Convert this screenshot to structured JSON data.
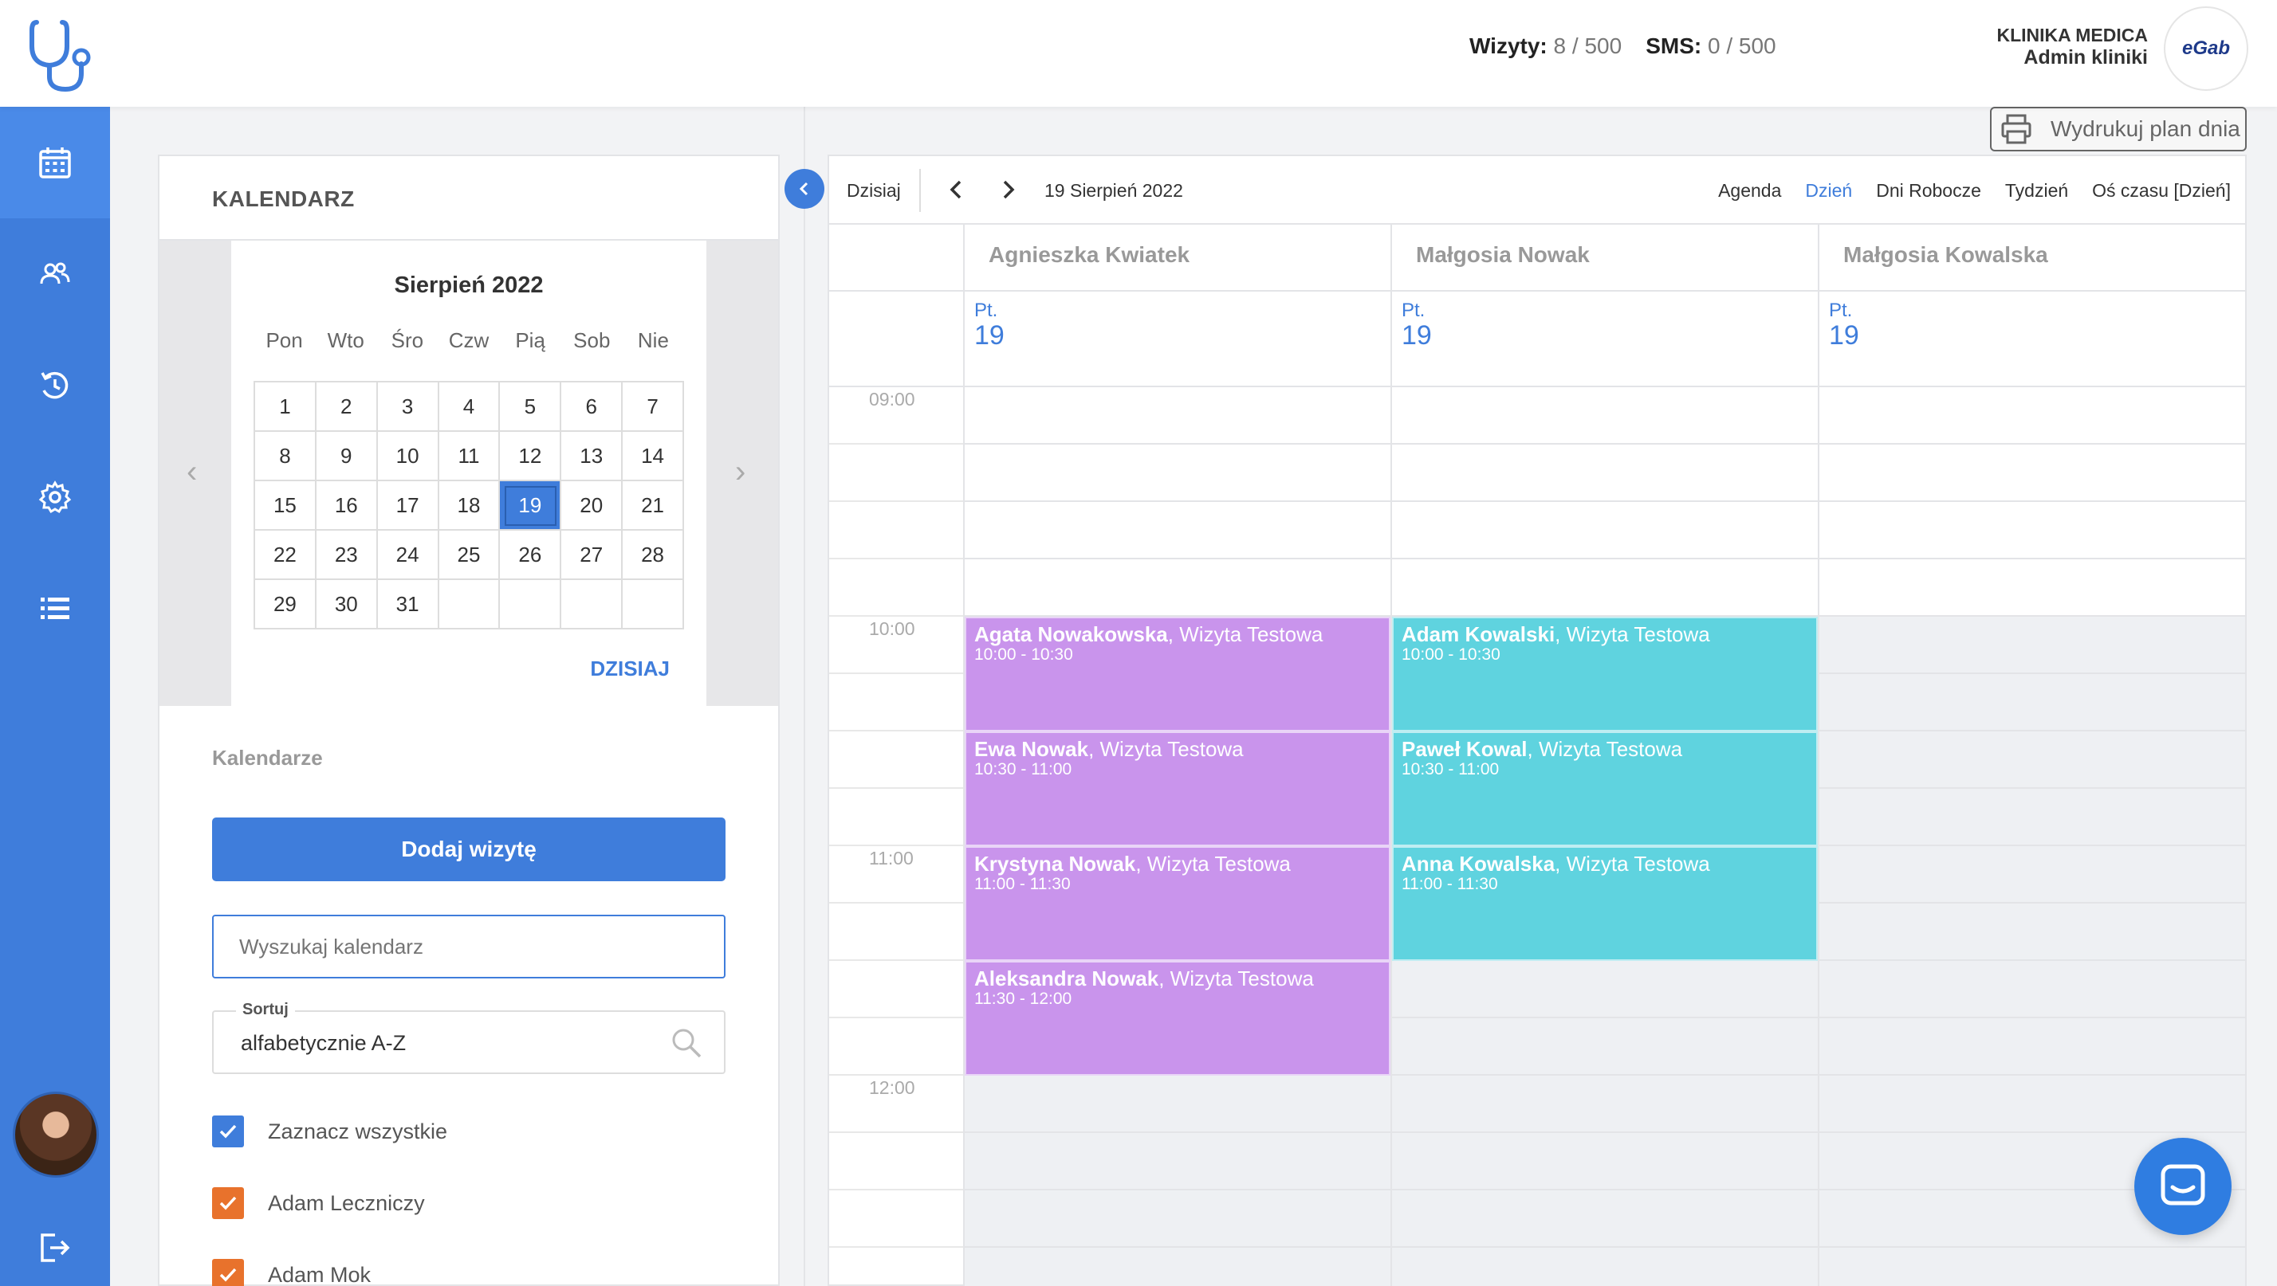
{
  "header": {
    "visits_label": "Wizyty:",
    "visits_value": "8 / 500",
    "sms_label": "SMS:",
    "sms_value": "0 / 500",
    "clinic_name": "KLINIKA MEDICA",
    "clinic_role": "Admin kliniki",
    "brand": "eGab"
  },
  "sidebar": {
    "items": [
      {
        "icon": "calendar-icon",
        "active": true
      },
      {
        "icon": "users-icon",
        "active": false
      },
      {
        "icon": "history-icon",
        "active": false
      },
      {
        "icon": "gear-icon",
        "active": false
      },
      {
        "icon": "list-icon",
        "active": false
      }
    ],
    "logout_icon": "logout-icon"
  },
  "left_panel": {
    "title": "KALENDARZ",
    "month_title": "Sierpień 2022",
    "weekdays": [
      "Pon",
      "Wto",
      "Śro",
      "Czw",
      "Pią",
      "Sob",
      "Nie"
    ],
    "days": [
      "1",
      "2",
      "3",
      "4",
      "5",
      "6",
      "7",
      "8",
      "9",
      "10",
      "11",
      "12",
      "13",
      "14",
      "15",
      "16",
      "17",
      "18",
      "19",
      "20",
      "21",
      "22",
      "23",
      "24",
      "25",
      "26",
      "27",
      "28",
      "29",
      "30",
      "31",
      "",
      "",
      "",
      ""
    ],
    "selected_day": "19",
    "today_link": "DZISIAJ",
    "calendars_section": "Kalendarze",
    "add_button": "Dodaj wizytę",
    "search_placeholder": "Wyszukaj kalendarz",
    "sort_label": "Sortuj",
    "sort_value": "alfabetycznie A-Z",
    "checkboxes": [
      {
        "label": "Zaznacz wszystkie",
        "color": "#3f7ddb",
        "checked": true
      },
      {
        "label": "Adam Leczniczy",
        "color": "#e8722c",
        "checked": true
      },
      {
        "label": "Adam Mok",
        "color": "#e8722c",
        "checked": true
      }
    ]
  },
  "print_button": "Wydrukuj plan dnia",
  "scheduler": {
    "today_button": "Dzisiaj",
    "current_date": "19 Sierpień 2022",
    "views": [
      "Agenda",
      "Dzień",
      "Dni Robocze",
      "Tydzień",
      "Oś czasu [Dzień]"
    ],
    "active_view": "Dzień",
    "resources": [
      "Agnieszka Kwiatek",
      "Małgosia Nowak",
      "Małgosia Kowalska"
    ],
    "day_of_week": "Pt.",
    "day_number": "19",
    "time_labels": [
      "09:00",
      "10:00",
      "11:00",
      "12:00"
    ],
    "appointments": [
      {
        "name": "Agata Nowakowska",
        "type": ", Wizyta Testowa",
        "time": "10:00 - 10:30"
      },
      {
        "name": "Ewa Nowak",
        "type": ", Wizyta Testowa",
        "time": "10:30 - 11:00"
      },
      {
        "name": "Krystyna Nowak",
        "type": ", Wizyta Testowa",
        "time": "11:00 - 11:30"
      },
      {
        "name": "Aleksandra Nowak",
        "type": ", Wizyta Testowa",
        "time": "11:30 - 12:00"
      },
      {
        "name": "Adam Kowalski",
        "type": ", Wizyta Testowa",
        "time": "10:00 - 10:30"
      },
      {
        "name": "Paweł Kowal",
        "type": ", Wizyta Testowa",
        "time": "10:30 - 11:00"
      },
      {
        "name": "Anna Kowalska",
        "type": ", Wizyta Testowa",
        "time": "11:00 - 11:30"
      }
    ]
  },
  "colors": {
    "accent": "#3f7ddb",
    "appt_purple": "#c994ec",
    "appt_cyan": "#5fd3df",
    "checkbox_orange": "#e8722c"
  }
}
